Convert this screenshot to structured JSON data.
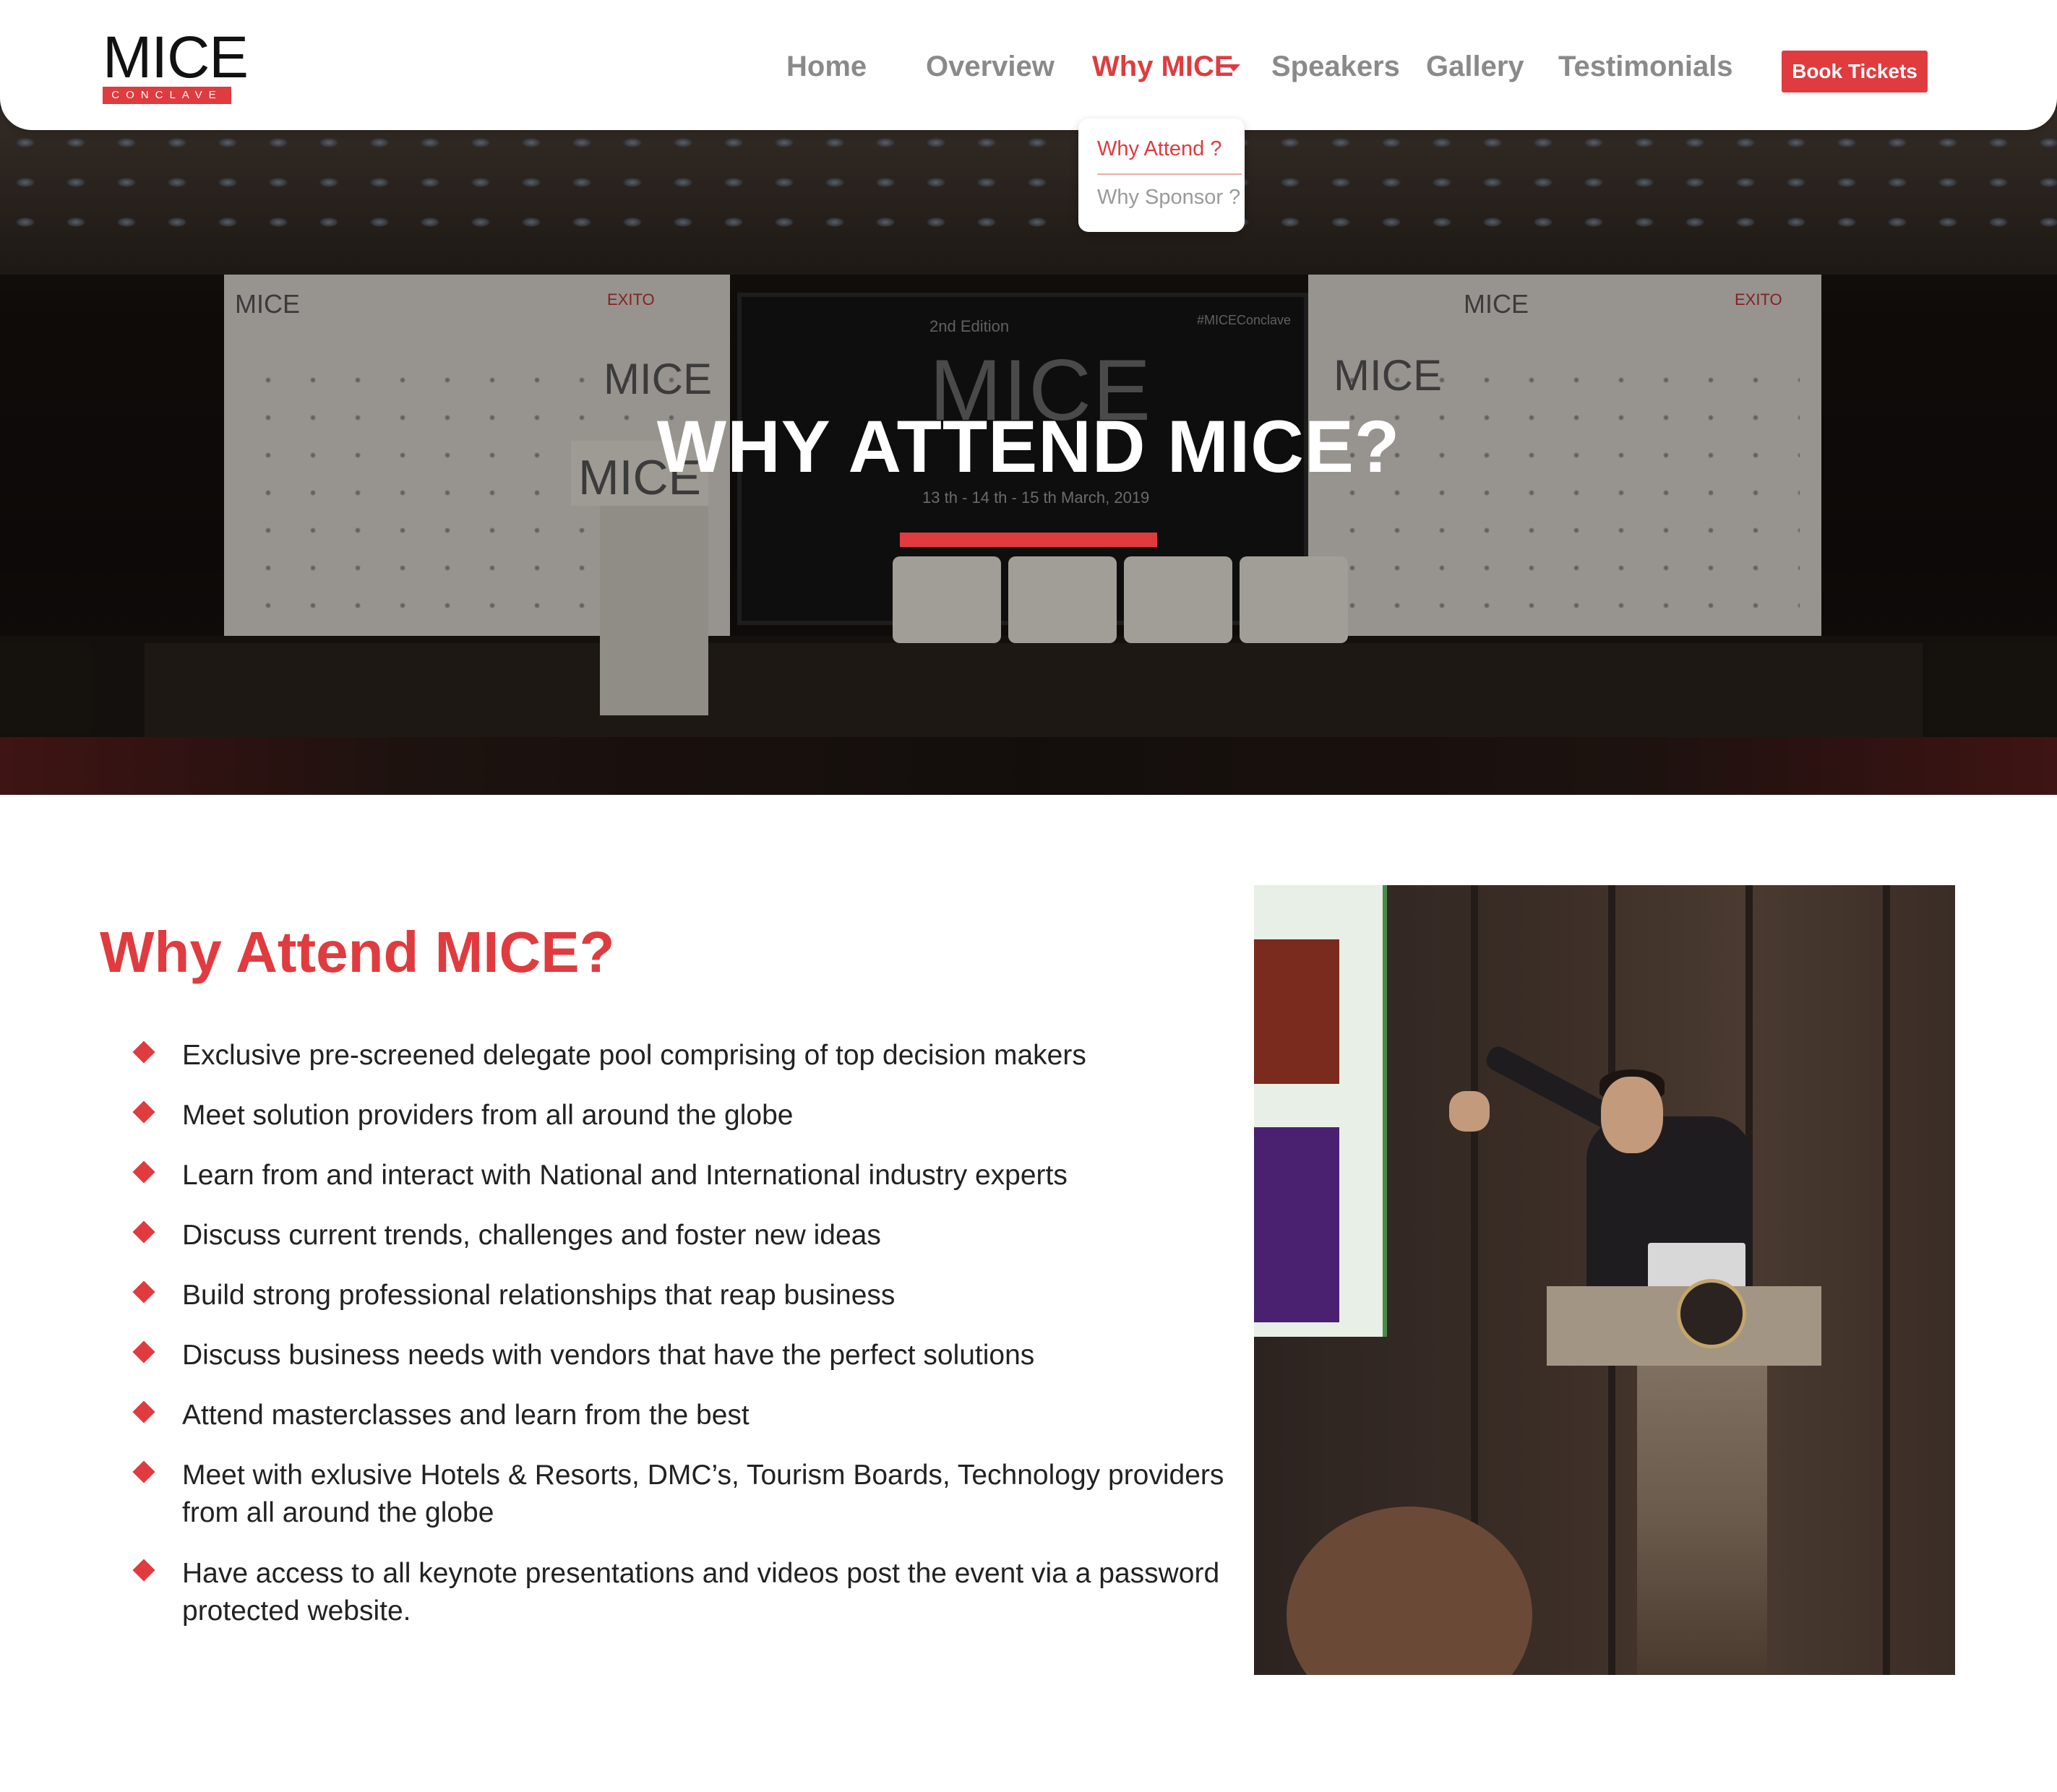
{
  "brand": {
    "name": "MICE",
    "subtitle": "CONCLAVE"
  },
  "nav": {
    "items": [
      {
        "label": "Home"
      },
      {
        "label": "Overview"
      },
      {
        "label": "Why MICE"
      },
      {
        "label": "Speakers"
      },
      {
        "label": "Gallery"
      },
      {
        "label": "Testimonials"
      }
    ],
    "active": "Why MICE",
    "cta": "Book Tickets",
    "dropdown": [
      {
        "label": "Why Attend ?"
      },
      {
        "label": "Why Sponsor ?"
      }
    ]
  },
  "hero": {
    "title": "WHY ATTEND MICE?",
    "backdrop": {
      "banner_brand": "MICE",
      "screen_edition": "2nd Edition",
      "screen_brand": "MICE",
      "screen_hashtag": "#MICEConclave",
      "screen_dates": "13 th - 14 th - 15 th March, 2019",
      "podium_brand": "MICE",
      "organizer": "EXITO"
    }
  },
  "section": {
    "title": "Why Attend MICE?",
    "bullets": [
      "Exclusive pre-screened delegate pool comprising  of top decision makers",
      "Meet solution providers from all around the globe",
      "Learn from and interact with National and International industry experts",
      "Discuss current trends, challenges and foster new ideas",
      "Build strong professional relationships that reap business",
      "Discuss business needs with vendors that have the perfect solutions",
      "Attend masterclasses and learn from the best",
      "Meet with exlusive Hotels & Resorts, DMC’s, Tourism Boards, Technology providers from all around the globe",
      "Have access to all keynote presentations and videos post the event via a password protected website."
    ]
  },
  "colors": {
    "accent": "#e03b3f",
    "nav_text": "#8a8a8a",
    "body_text": "#222222"
  }
}
